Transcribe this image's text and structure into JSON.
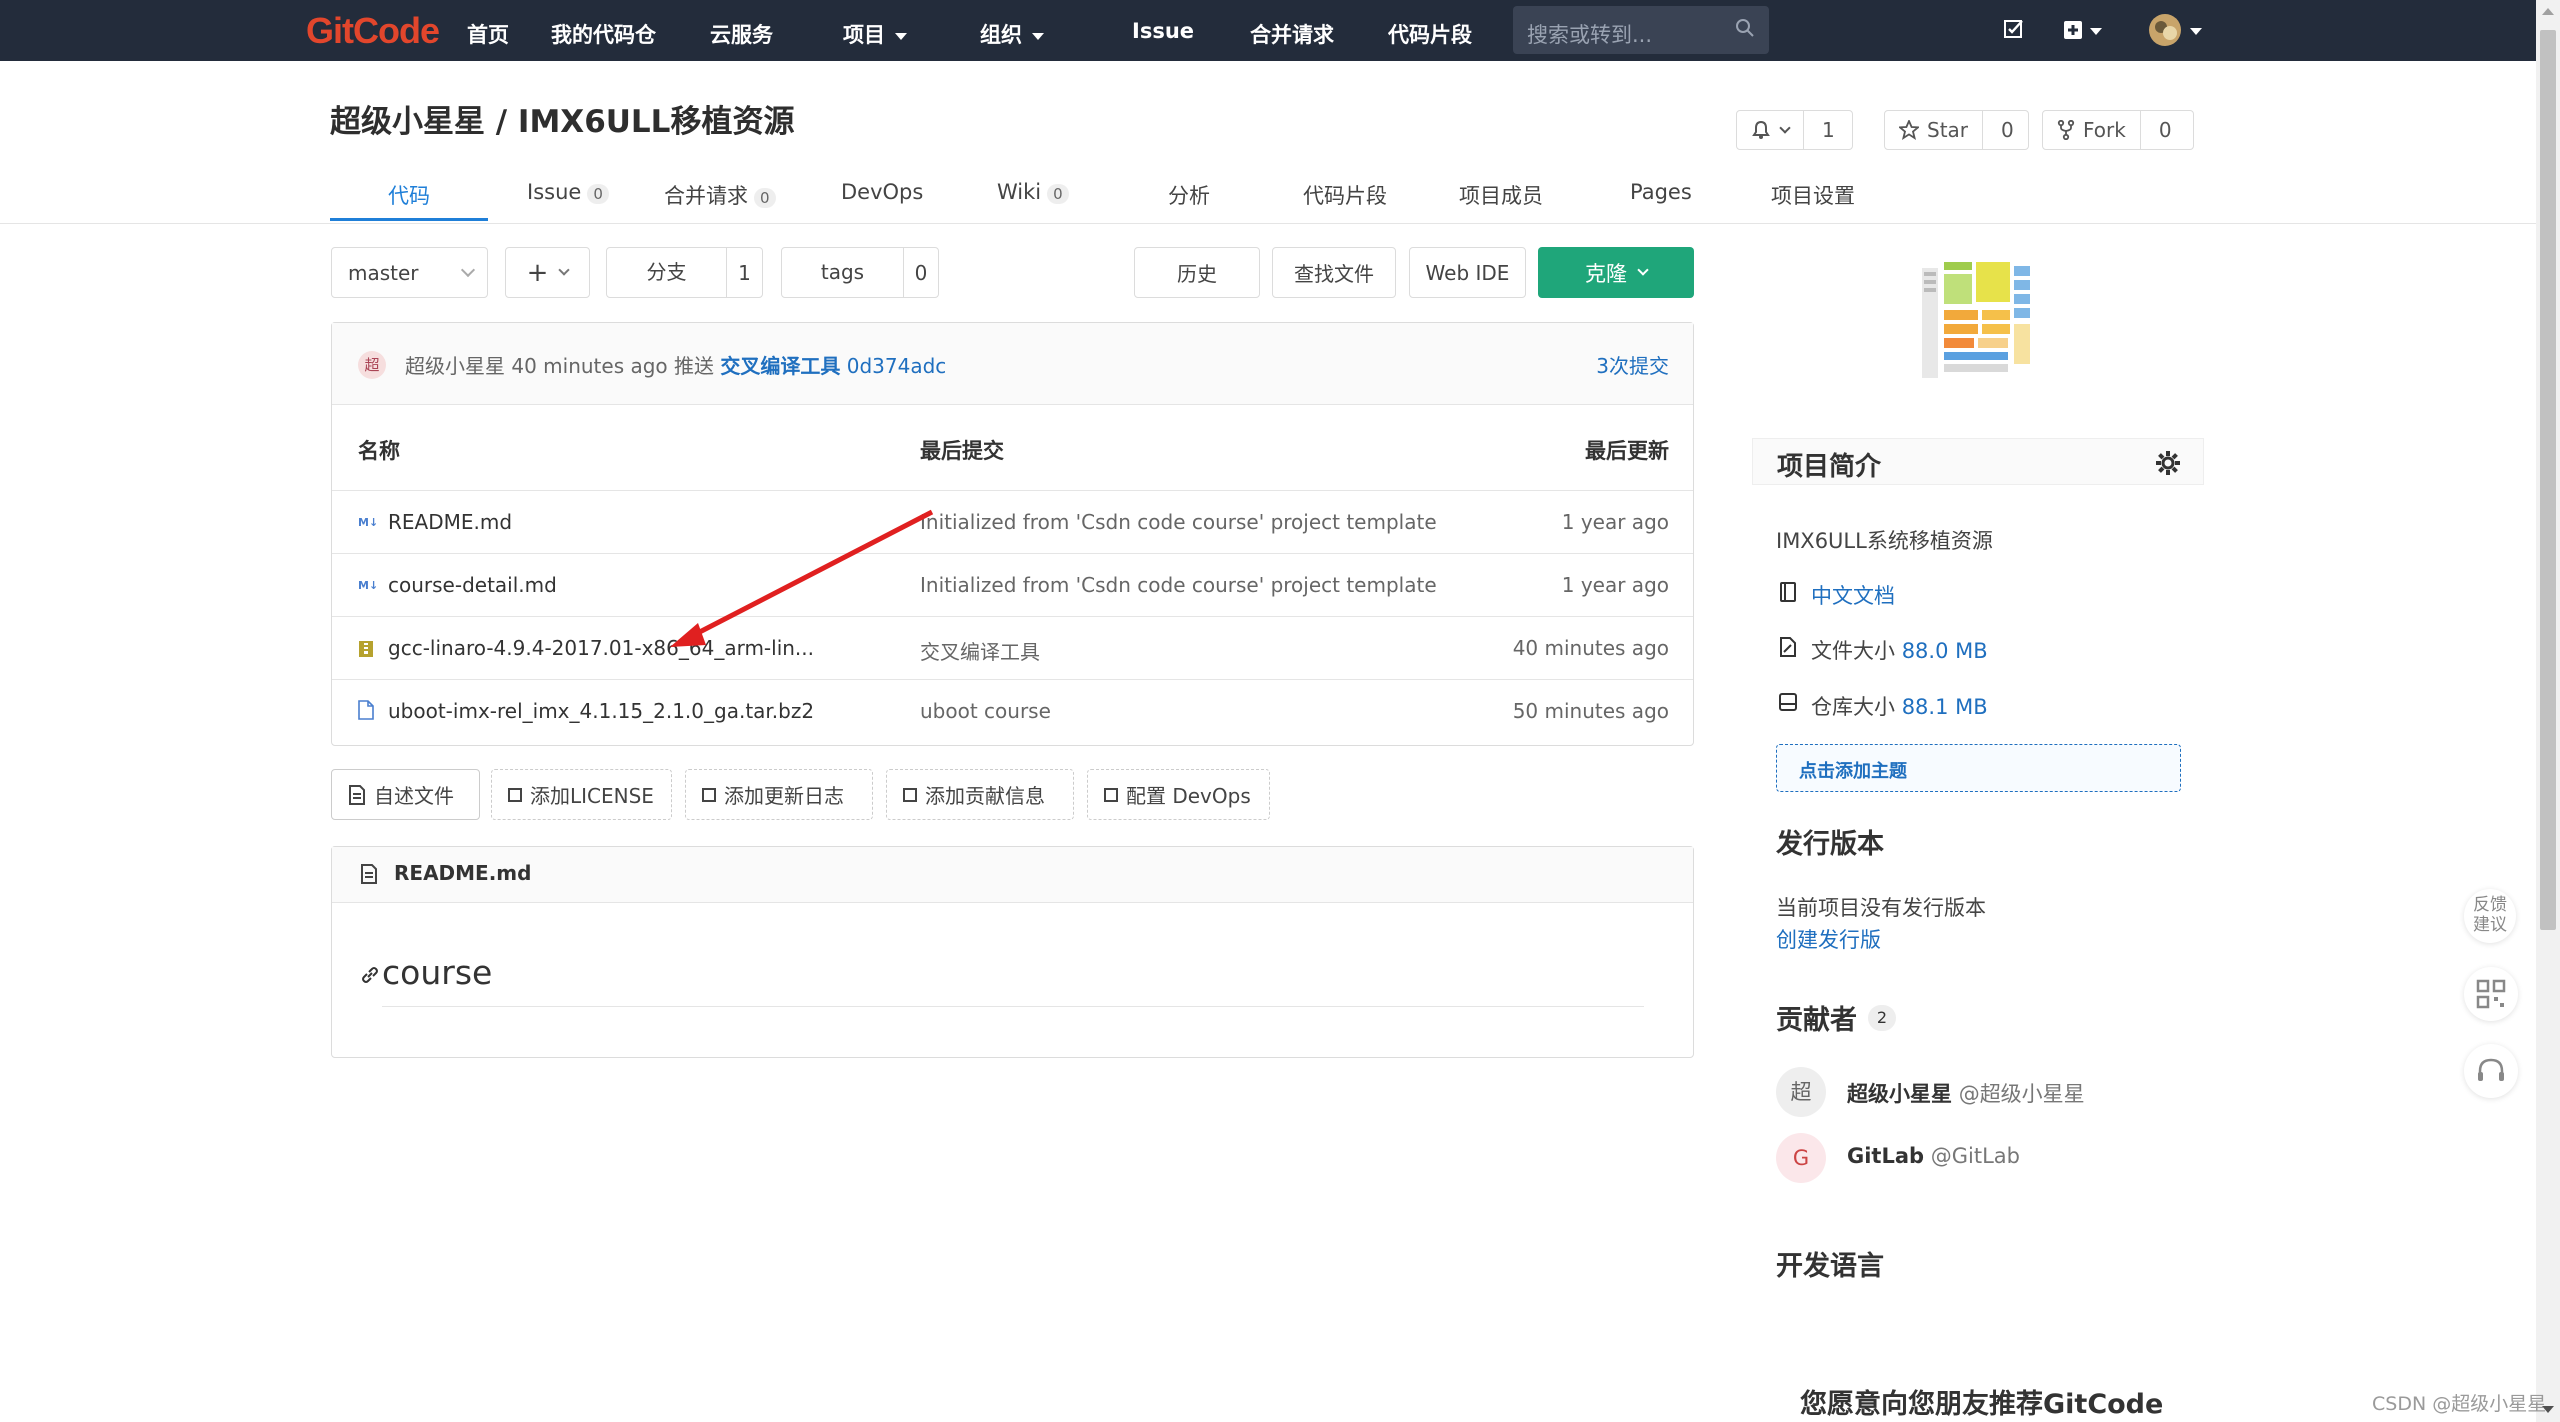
{
  "nav": {
    "logo": "GitCode",
    "items": [
      {
        "label": "首页"
      },
      {
        "label": "我的代码仓"
      },
      {
        "label": "云服务"
      },
      {
        "label": "项目"
      },
      {
        "label": "组织"
      },
      {
        "label": "Issue"
      },
      {
        "label": "合并请求"
      },
      {
        "label": "代码片段"
      }
    ],
    "search_placeholder": "搜索或转到..."
  },
  "repo": {
    "title": "超级小星星 / IMX6ULL移植资源",
    "notify_count": "1",
    "star_label": "Star",
    "star_count": "0",
    "fork_label": "Fork",
    "fork_count": "0"
  },
  "tabs": [
    {
      "label": "代码"
    },
    {
      "label": "Issue",
      "count": "0"
    },
    {
      "label": "合并请求",
      "count": "0"
    },
    {
      "label": "DevOps"
    },
    {
      "label": "Wiki",
      "count": "0"
    },
    {
      "label": "分析"
    },
    {
      "label": "代码片段"
    },
    {
      "label": "项目成员"
    },
    {
      "label": "Pages"
    },
    {
      "label": "项目设置"
    }
  ],
  "toolbar": {
    "branch": "master",
    "plus": "+",
    "branches_label": "分支",
    "branches_count": "1",
    "tags_label": "tags",
    "tags_count": "0",
    "history": "历史",
    "find_file": "查找文件",
    "web_ide": "Web IDE",
    "clone": "克隆"
  },
  "last_commit": {
    "avatar": "超",
    "author": "超级小星星",
    "time": "40 minutes ago",
    "action": "推送",
    "message": "交叉编译工具",
    "sha": "0d374adc",
    "count_link": "3次提交"
  },
  "table": {
    "headers": [
      "名称",
      "最后提交",
      "最后更新"
    ],
    "rows": [
      {
        "name": "README.md",
        "commit": "Initialized from 'Csdn code course' project template",
        "updated": "1 year ago",
        "icon": "markdown-icon"
      },
      {
        "name": "course-detail.md",
        "commit": "Initialized from 'Csdn code course' project template",
        "updated": "1 year ago",
        "icon": "markdown-icon"
      },
      {
        "name": "gcc-linaro-4.9.4-2017.01-x86_64_arm-lin...",
        "commit": "交叉编译工具",
        "updated": "40 minutes ago",
        "icon": "archive-icon"
      },
      {
        "name": "uboot-imx-rel_imx_4.1.15_2.1.0_ga.tar.bz2",
        "commit": "uboot course",
        "updated": "50 minutes ago",
        "icon": "file-icon"
      }
    ]
  },
  "actions": [
    "自述文件",
    "添加LICENSE",
    "添加更新日志",
    "添加贡献信息",
    "配置 DevOps"
  ],
  "readme": {
    "filename": "README.md",
    "heading": "course"
  },
  "sidebar": {
    "intro_title": "项目简介",
    "description": "IMX6ULL系统移植资源",
    "doc_link": "中文文档",
    "file_size_label": "文件大小",
    "file_size": "88.0 MB",
    "repo_size_label": "仓库大小",
    "repo_size": "88.1 MB",
    "add_topic": "点击添加主题",
    "releases_title": "发行版本",
    "releases_empty": "当前项目没有发行版本",
    "create_release": "创建发行版",
    "contributors_title": "贡献者",
    "contributors_count": "2",
    "contributors": [
      {
        "avatar": "超",
        "name": "超级小星星",
        "handle": "@超级小星星"
      },
      {
        "avatar": "G",
        "name": "GitLab",
        "handle": "@GitLab"
      }
    ],
    "languages_title": "开发语言",
    "recommend_title": "您愿意向您朋友推荐GitCode"
  },
  "float": {
    "feedback": "反馈建议"
  },
  "watermark": "CSDN @超级小星星",
  "colors": {
    "topbar": "#232c3b",
    "accent": "#1f7fd8",
    "clone_button": "#1fa67a",
    "annotation_arrow": "#e02020"
  }
}
